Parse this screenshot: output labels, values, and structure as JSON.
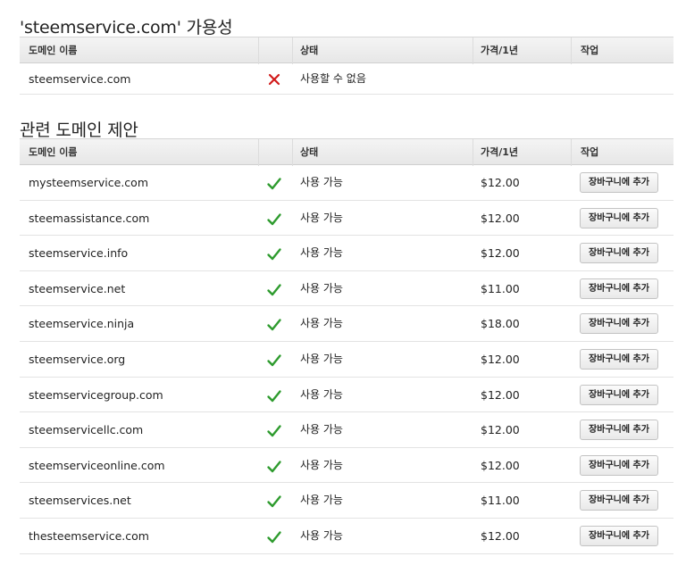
{
  "availability": {
    "title": "'steemservice.com' 가용성",
    "headers": {
      "domain": "도메인 이름",
      "status": "상태",
      "price": "가격/1년",
      "action": "작업"
    },
    "row": {
      "domain": "steemservice.com",
      "status": "사용할 수 없음",
      "icon": "x-icon"
    }
  },
  "suggestions": {
    "title": "관련 도메인 제안",
    "headers": {
      "domain": "도메인 이름",
      "status": "상태",
      "price": "가격/1년",
      "action": "작업"
    },
    "button_label": "장바구니에 추가",
    "rows": [
      {
        "domain": "mysteemservice.com",
        "status": "사용 가능",
        "price": "$12.00"
      },
      {
        "domain": "steemassistance.com",
        "status": "사용 가능",
        "price": "$12.00"
      },
      {
        "domain": "steemservice.info",
        "status": "사용 가능",
        "price": "$12.00"
      },
      {
        "domain": "steemservice.net",
        "status": "사용 가능",
        "price": "$11.00"
      },
      {
        "domain": "steemservice.ninja",
        "status": "사용 가능",
        "price": "$18.00"
      },
      {
        "domain": "steemservice.org",
        "status": "사용 가능",
        "price": "$12.00"
      },
      {
        "domain": "steemservicegroup.com",
        "status": "사용 가능",
        "price": "$12.00"
      },
      {
        "domain": "steemservicellc.com",
        "status": "사용 가능",
        "price": "$12.00"
      },
      {
        "domain": "steemserviceonline.com",
        "status": "사용 가능",
        "price": "$12.00"
      },
      {
        "domain": "steemservices.net",
        "status": "사용 가능",
        "price": "$11.00"
      },
      {
        "domain": "thesteemservice.com",
        "status": "사용 가능",
        "price": "$12.00"
      }
    ]
  },
  "colors": {
    "available": "#2e9b2e",
    "unavailable": "#d11a1a"
  }
}
